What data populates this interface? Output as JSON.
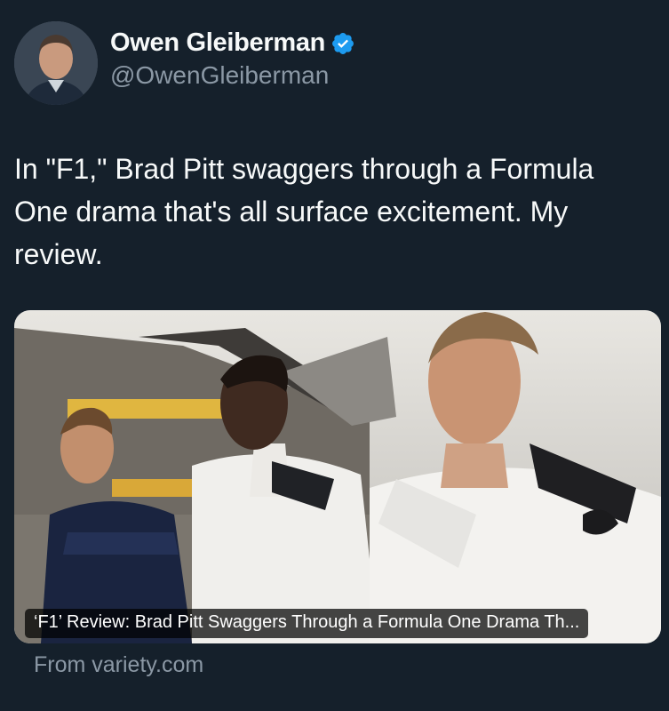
{
  "author": {
    "display_name": "Owen Gleiberman",
    "handle": "@OwenGleiberman",
    "verified": true,
    "verified_color": "#1d9bf0"
  },
  "tweet": {
    "text": "In \"F1,\" Brad Pitt swaggers through a Formula One drama that's all surface excitement. My review."
  },
  "link_card": {
    "title": "‘F1’ Review: Brad Pitt Swaggers Through a Formula One Drama Th...",
    "source": "From variety.com"
  },
  "colors": {
    "background": "#15202b",
    "text": "#f7f9f9",
    "secondary_text": "#8b98a5"
  }
}
